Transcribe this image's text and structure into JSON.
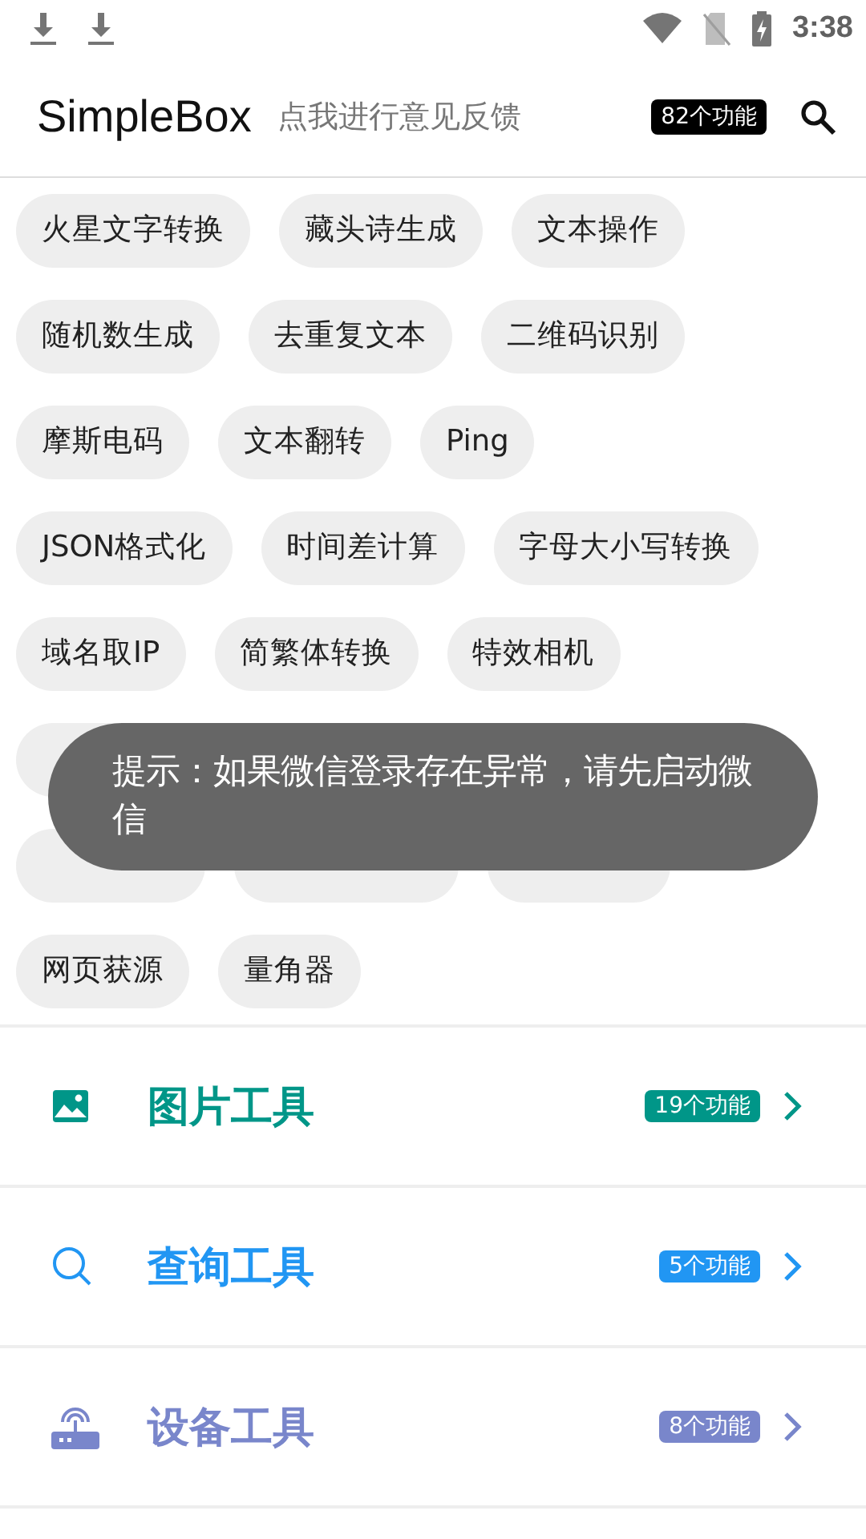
{
  "status_bar": {
    "time": "3:38"
  },
  "header": {
    "title": "SimpleBox",
    "feedback": "点我进行意见反馈",
    "count_badge": "82个功能"
  },
  "chip_rows": [
    [
      "火星文字转换",
      "藏头诗生成",
      "文本操作"
    ],
    [
      "随机数生成",
      "去重复文本",
      "二维码识别"
    ],
    [
      "摩斯电码",
      "文本翻转",
      "Ping"
    ],
    [
      "JSON格式化",
      "时间差计算",
      "字母大小写转换"
    ],
    [
      "域名取IP",
      "简繁体转换",
      "特效相机"
    ],
    [
      "网页获源",
      "量角器"
    ]
  ],
  "toast": {
    "text": "提示：如果微信登录存在异常，请先启动微信"
  },
  "categories": [
    {
      "kind": "image",
      "title": "图片工具",
      "badge": "19个功能",
      "color": "#009688"
    },
    {
      "kind": "search",
      "title": "查询工具",
      "badge": "5个功能",
      "color": "#2196f3"
    },
    {
      "kind": "router",
      "title": "设备工具",
      "badge": "8个功能",
      "color": "#7986cb"
    }
  ]
}
